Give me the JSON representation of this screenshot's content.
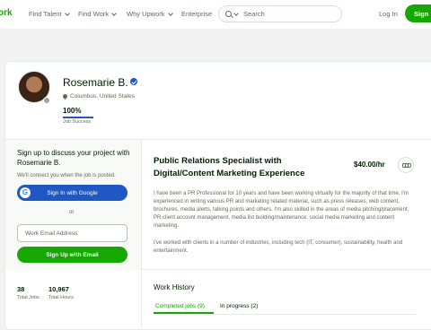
{
  "nav": {
    "logo": "ork",
    "find_talent": "Find Talent",
    "find_work": "Find Work",
    "why_upwork": "Why Upwork",
    "enterprise": "Enterprise",
    "search_placeholder": "Search",
    "login": "Log In",
    "signup": "Sign"
  },
  "profile": {
    "name": "Rosemarie B.",
    "location": "Columbus, United States",
    "job_success_value": "100%",
    "job_success_label": "Job Success",
    "job_success_fraction": 1.0
  },
  "signup_panel": {
    "title": "Sign up to discuss your project with Rosemarie B.",
    "subtitle": "We'll connect you when the job is posted.",
    "google_button": "Sign In with Google",
    "or_label": "or",
    "email_placeholder": "Work Email Address",
    "email_button": "Sign Up with Email"
  },
  "stats": [
    {
      "value": "38",
      "label": "Total Jobs"
    },
    {
      "value": "10,967",
      "label": "Total Hours"
    }
  ],
  "job": {
    "title": "Public Relations Specialist with Digital/Content Marketing Experience",
    "rate": "$40.00/hr",
    "bio_1": "I have been a PR Professional for 10 years and have been working virtually for the majority of that time. I'm experienced in writing various PR and marketing related material, such as press releases, web content, brochures, media alerts, talking points and others. I'm also skilled in the areas of media pitching/placement, PR client account management, media list building/maintenance, social media marketing and content marketing.",
    "bio_2": "I've worked with clients in a number of industries, including tech (IT, consumer), sustainability, health and entertainment."
  },
  "work_history": {
    "title": "Work History",
    "tab_completed": "Completed jobs (9)",
    "tab_in_progress": "In progress (2)"
  },
  "colors": {
    "brand_green": "#14a800",
    "google_blue": "#1f57c3",
    "text_dark": "#001e00",
    "text_muted": "#5e6d55"
  }
}
